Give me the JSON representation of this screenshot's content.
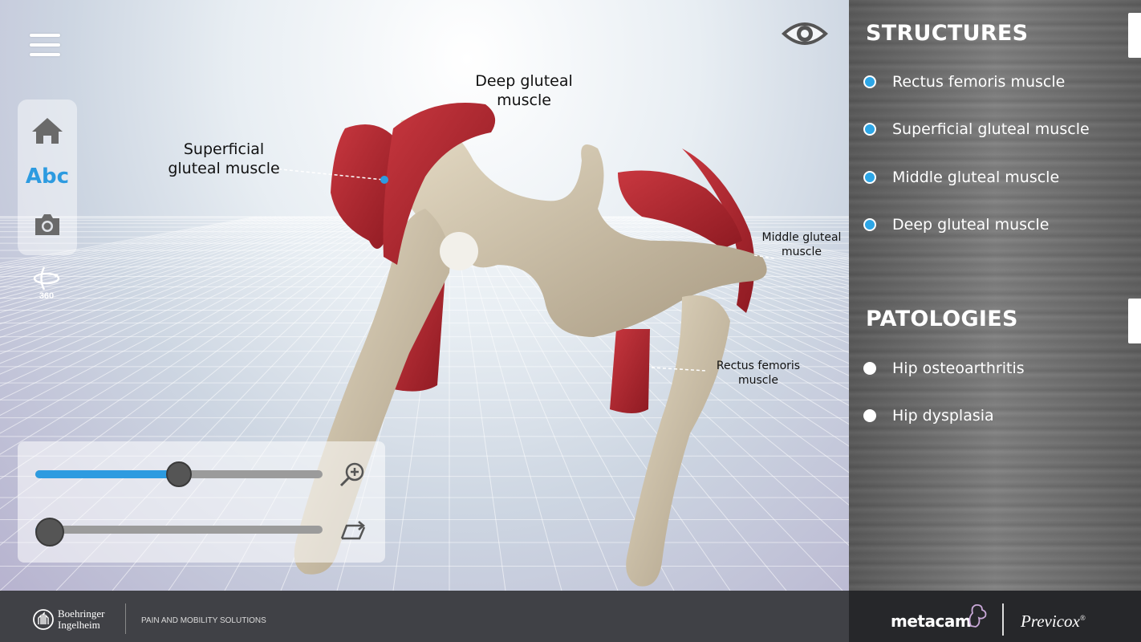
{
  "labels": {
    "deep_gluteal": "Deep gluteal muscle",
    "superficial_gluteal": "Superficial gluteal muscle",
    "middle_gluteal": "Middle gluteal muscle",
    "rectus_femoris": "Rectus femoris muscle"
  },
  "toolbar": {
    "abc": "Abc",
    "rotate_360": "360"
  },
  "sliders": {
    "zoom_value": 0.5,
    "rotate_value": 0.05
  },
  "structures": {
    "heading": "STRUCTURES",
    "items": [
      {
        "label": "Rectus femoris muscle"
      },
      {
        "label": "Superficial gluteal muscle"
      },
      {
        "label": "Middle gluteal muscle"
      },
      {
        "label": "Deep gluteal muscle"
      }
    ]
  },
  "pathologies": {
    "heading": "PATOLOGIES",
    "items": [
      {
        "label": "Hip osteoarthritis"
      },
      {
        "label": "Hip dysplasia"
      }
    ]
  },
  "footer": {
    "bi_line1": "Boehringer",
    "bi_line2": "Ingelheim",
    "tagline": "PAIN AND MOBILITY SOLUTIONS",
    "brand1": "metacam",
    "brand2": "Previcox",
    "brand2_mark": "®"
  },
  "colors": {
    "accent": "#2d9be0",
    "muscle": "#b5252e",
    "bone": "#d8cbb5"
  }
}
